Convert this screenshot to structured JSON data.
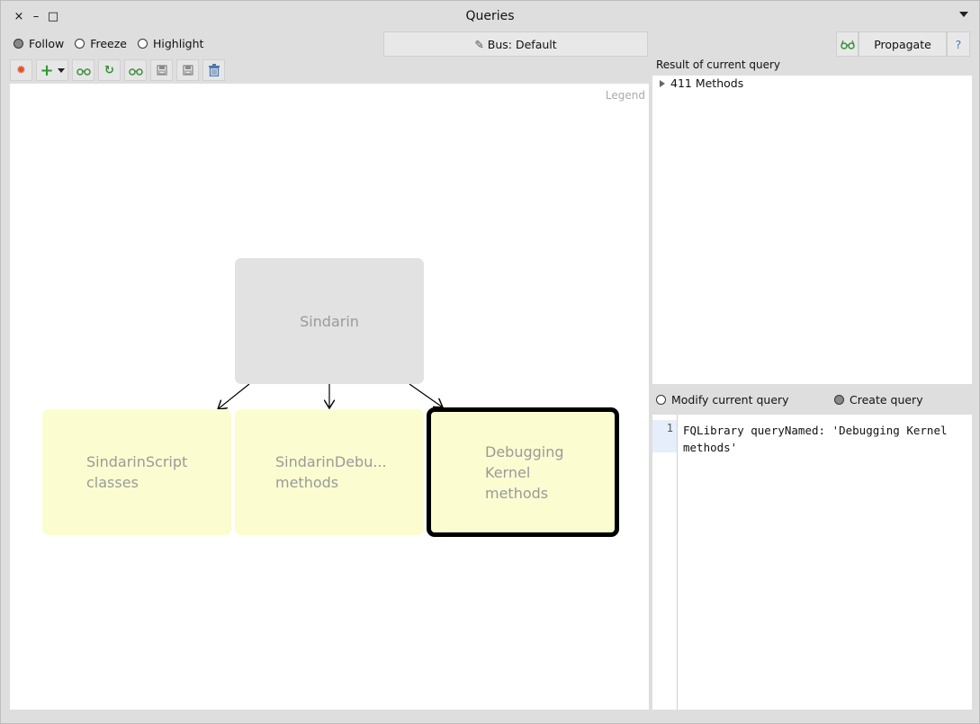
{
  "window": {
    "title": "Queries",
    "close": "×",
    "minimize": "–",
    "maximize": "□"
  },
  "modes": [
    {
      "label": "Follow",
      "selected": true
    },
    {
      "label": "Freeze",
      "selected": false
    },
    {
      "label": "Highlight",
      "selected": false
    }
  ],
  "bus": {
    "icon": "✎",
    "label": "Bus: Default"
  },
  "propagate": {
    "icon": "glasses-icon",
    "label": "Propagate",
    "help": "?"
  },
  "toolbar": [
    {
      "name": "reset-icon",
      "glyph": "✹",
      "color": "#e0552a"
    },
    {
      "name": "add-query-icon",
      "glyph": "+",
      "color": "#2f9a2f"
    },
    {
      "name": "browse-icon",
      "glyph": "◉",
      "color": "#3c8f3c"
    },
    {
      "name": "refresh-icon",
      "glyph": "↻",
      "color": "#3c8f3c"
    },
    {
      "name": "inspect-icon",
      "glyph": "◉",
      "color": "#3c8f3c"
    },
    {
      "name": "save-icon",
      "glyph": "▤",
      "color": "#8a8a8a"
    },
    {
      "name": "save-as-icon",
      "glyph": "▤",
      "color": "#8a8a8a"
    },
    {
      "name": "trash-icon",
      "glyph": "🗑",
      "color": "#4a78b0"
    }
  ],
  "canvas": {
    "legend": "Legend",
    "root": {
      "label": "Sindarin"
    },
    "children": [
      {
        "line1": "SindarinScript",
        "line2": "classes",
        "line3": ""
      },
      {
        "line1": "SindarinDebu...",
        "line2": "methods",
        "line3": ""
      },
      {
        "line1": "Debugging",
        "line2": "Kernel",
        "line3": "methods"
      }
    ]
  },
  "result": {
    "header": "Result of current query",
    "items": [
      {
        "label": "411 Methods"
      }
    ]
  },
  "query_modes": [
    {
      "label": "Modify current query",
      "selected": false
    },
    {
      "label": "Create query",
      "selected": true
    }
  ],
  "editor": {
    "line_number": "1",
    "code": "FQLibrary queryNamed: 'Debugging Kernel methods'"
  }
}
